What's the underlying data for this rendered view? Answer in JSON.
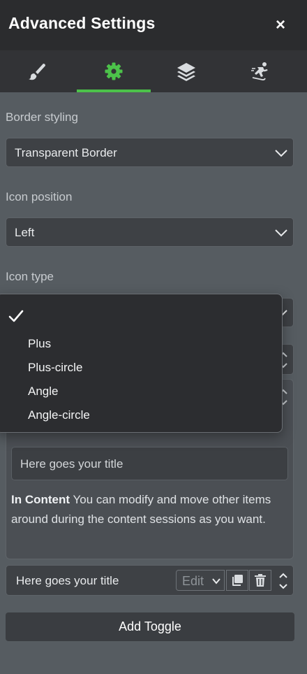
{
  "header": {
    "title": "Advanced Settings",
    "close_label": "×"
  },
  "tabs": [
    {
      "icon": "brush-icon"
    },
    {
      "icon": "gear-icon",
      "active": true
    },
    {
      "icon": "layers-icon"
    },
    {
      "icon": "skater-icon"
    }
  ],
  "accent_color": "#4cc24a",
  "fields": {
    "border_styling": {
      "label": "Border styling",
      "value": "Transparent Border"
    },
    "icon_position": {
      "label": "Icon position",
      "value": "Left"
    },
    "icon_type": {
      "label": "Icon type"
    }
  },
  "dropdown": {
    "selected_mark": "✓",
    "options": [
      "Plus",
      "Plus-circle",
      "Angle",
      "Angle-circle"
    ]
  },
  "toggle_panel": {
    "title_value": "Here goes your title",
    "content_bold": "In Content",
    "content_text": " You can modify and move other items around during the content sessions as you want."
  },
  "toggle_item": {
    "title": "Here goes your title",
    "edit_label": "Edit"
  },
  "add_button_label": "Add Toggle"
}
